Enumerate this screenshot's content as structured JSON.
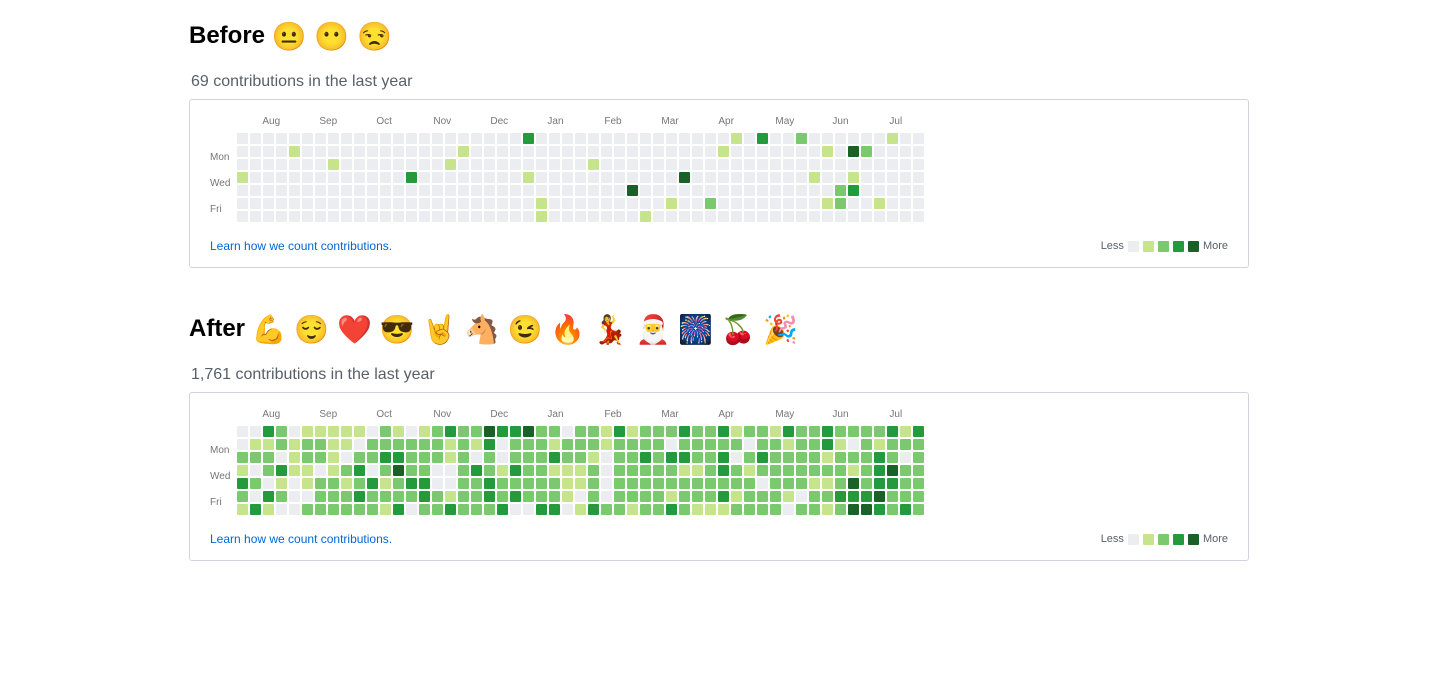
{
  "chart_data": [
    {
      "type": "heatmap",
      "name": "before",
      "title": "Before",
      "subtitle": "69 contributions in the last year",
      "months": [
        "Aug",
        "Sep",
        "Oct",
        "Nov",
        "Dec",
        "Jan",
        "Feb",
        "Mar",
        "Apr",
        "May",
        "Jun",
        "Jul"
      ],
      "day_labels": [
        "Mon",
        "Wed",
        "Fri"
      ],
      "legend": {
        "less": "Less",
        "more": "More",
        "levels": 5
      }
    },
    {
      "type": "heatmap",
      "name": "after",
      "title": "After",
      "subtitle": "1,761 contributions in the last year",
      "months": [
        "Aug",
        "Sep",
        "Oct",
        "Nov",
        "Dec",
        "Jan",
        "Feb",
        "Mar",
        "Apr",
        "May",
        "Jun",
        "Jul"
      ],
      "day_labels": [
        "Mon",
        "Wed",
        "Fri"
      ],
      "legend": {
        "less": "Less",
        "more": "More",
        "levels": 5
      }
    }
  ],
  "before": {
    "title": "Before",
    "emojis": "😐 😶 😒",
    "sub": "69 contributions in the last year",
    "learn": "Learn how we count contributions.",
    "less": "Less",
    "more": "More",
    "months": [
      "Aug",
      "Sep",
      "Oct",
      "Nov",
      "Dec",
      "Jan",
      "Feb",
      "Mar",
      "Apr",
      "May",
      "Jun",
      "Jul"
    ],
    "days": {
      "mon": "Mon",
      "wed": "Wed",
      "fri": "Fri"
    },
    "weeks": [
      [
        0,
        0,
        0,
        1,
        0,
        0,
        0
      ],
      [
        0,
        0,
        0,
        0,
        0,
        0,
        0
      ],
      [
        0,
        0,
        0,
        0,
        0,
        0,
        0
      ],
      [
        0,
        0,
        0,
        0,
        0,
        0,
        0
      ],
      [
        0,
        1,
        0,
        0,
        0,
        0,
        0
      ],
      [
        0,
        0,
        0,
        0,
        0,
        0,
        0
      ],
      [
        0,
        0,
        0,
        0,
        0,
        0,
        0
      ],
      [
        0,
        0,
        1,
        0,
        0,
        0,
        0
      ],
      [
        0,
        0,
        0,
        0,
        0,
        0,
        0
      ],
      [
        0,
        0,
        0,
        0,
        0,
        0,
        0
      ],
      [
        0,
        0,
        0,
        0,
        0,
        0,
        0
      ],
      [
        0,
        0,
        0,
        0,
        0,
        0,
        0
      ],
      [
        0,
        0,
        0,
        0,
        0,
        0,
        0
      ],
      [
        0,
        0,
        0,
        3,
        0,
        0,
        0
      ],
      [
        0,
        0,
        0,
        0,
        0,
        0,
        0
      ],
      [
        0,
        0,
        0,
        0,
        0,
        0,
        0
      ],
      [
        0,
        0,
        1,
        0,
        0,
        0,
        0
      ],
      [
        0,
        1,
        0,
        0,
        0,
        0,
        0
      ],
      [
        0,
        0,
        0,
        0,
        0,
        0,
        0
      ],
      [
        0,
        0,
        0,
        0,
        0,
        0,
        0
      ],
      [
        0,
        0,
        0,
        0,
        0,
        0,
        0
      ],
      [
        0,
        0,
        0,
        0,
        0,
        0,
        0
      ],
      [
        3,
        0,
        0,
        1,
        0,
        0,
        0
      ],
      [
        0,
        0,
        0,
        0,
        0,
        1,
        1
      ],
      [
        0,
        0,
        0,
        0,
        0,
        0,
        0
      ],
      [
        0,
        0,
        0,
        0,
        0,
        0,
        0
      ],
      [
        0,
        0,
        0,
        0,
        0,
        0,
        0
      ],
      [
        0,
        0,
        1,
        0,
        0,
        0,
        0
      ],
      [
        0,
        0,
        0,
        0,
        0,
        0,
        0
      ],
      [
        0,
        0,
        0,
        0,
        0,
        0,
        0
      ],
      [
        0,
        0,
        0,
        0,
        4,
        0,
        0
      ],
      [
        0,
        0,
        0,
        0,
        0,
        0,
        1
      ],
      [
        0,
        0,
        0,
        0,
        0,
        0,
        0
      ],
      [
        0,
        0,
        0,
        0,
        0,
        1,
        0
      ],
      [
        0,
        0,
        0,
        4,
        0,
        0,
        0
      ],
      [
        0,
        0,
        0,
        0,
        0,
        0,
        0
      ],
      [
        0,
        0,
        0,
        0,
        0,
        2,
        0
      ],
      [
        0,
        1,
        0,
        0,
        0,
        0,
        0
      ],
      [
        1,
        0,
        0,
        0,
        0,
        0,
        0
      ],
      [
        0,
        0,
        0,
        0,
        0,
        0,
        0
      ],
      [
        3,
        0,
        0,
        0,
        0,
        0,
        0
      ],
      [
        0,
        0,
        0,
        0,
        0,
        0,
        0
      ],
      [
        0,
        0,
        0,
        0,
        0,
        0,
        0
      ],
      [
        2,
        0,
        0,
        0,
        0,
        0,
        0
      ],
      [
        0,
        0,
        0,
        1,
        0,
        0,
        0
      ],
      [
        0,
        1,
        0,
        0,
        0,
        1,
        0
      ],
      [
        0,
        0,
        0,
        0,
        2,
        2,
        0
      ],
      [
        0,
        4,
        0,
        1,
        3,
        0,
        0
      ],
      [
        0,
        2,
        0,
        0,
        0,
        0,
        0
      ],
      [
        0,
        0,
        0,
        0,
        0,
        1,
        0
      ],
      [
        1,
        0,
        0,
        0,
        0,
        0,
        0
      ],
      [
        0,
        0,
        0,
        0,
        0,
        0,
        0
      ],
      [
        0,
        0,
        0,
        0,
        0,
        0,
        0
      ]
    ]
  },
  "after": {
    "title": "After",
    "emojis": "💪 😌 ❤️ 😎 🤘 🐴 😉 🔥 💃 🎅 🎆 🍒 🎉",
    "sub": "1,761 contributions in the last year",
    "learn": "Learn how we count contributions.",
    "less": "Less",
    "more": "More",
    "months": [
      "Aug",
      "Sep",
      "Oct",
      "Nov",
      "Dec",
      "Jan",
      "Feb",
      "Mar",
      "Apr",
      "May",
      "Jun",
      "Jul"
    ],
    "days": {
      "mon": "Mon",
      "wed": "Wed",
      "fri": "Fri"
    },
    "weeks": [
      [
        0,
        0,
        2,
        1,
        3,
        2,
        1
      ],
      [
        0,
        1,
        2,
        0,
        2,
        0,
        3
      ],
      [
        3,
        1,
        2,
        2,
        0,
        3,
        1
      ],
      [
        2,
        2,
        0,
        3,
        1,
        2,
        0
      ],
      [
        0,
        1,
        1,
        1,
        0,
        0,
        0
      ],
      [
        1,
        2,
        2,
        1,
        1,
        0,
        2
      ],
      [
        1,
        2,
        2,
        0,
        2,
        2,
        2
      ],
      [
        1,
        1,
        1,
        1,
        2,
        2,
        2
      ],
      [
        1,
        1,
        0,
        2,
        1,
        2,
        2
      ],
      [
        1,
        0,
        2,
        3,
        2,
        3,
        2
      ],
      [
        0,
        2,
        2,
        0,
        3,
        2,
        2
      ],
      [
        2,
        2,
        3,
        2,
        1,
        2,
        1
      ],
      [
        1,
        2,
        3,
        4,
        2,
        2,
        3
      ],
      [
        0,
        2,
        2,
        2,
        3,
        2,
        0
      ],
      [
        1,
        2,
        2,
        2,
        3,
        3,
        2
      ],
      [
        2,
        2,
        2,
        0,
        0,
        2,
        2
      ],
      [
        3,
        1,
        1,
        0,
        0,
        1,
        3
      ],
      [
        2,
        2,
        2,
        2,
        2,
        2,
        2
      ],
      [
        2,
        1,
        0,
        3,
        2,
        2,
        2
      ],
      [
        4,
        3,
        2,
        2,
        3,
        3,
        2
      ],
      [
        3,
        0,
        0,
        1,
        2,
        2,
        3
      ],
      [
        3,
        2,
        2,
        3,
        2,
        3,
        0
      ],
      [
        4,
        2,
        2,
        2,
        2,
        2,
        0
      ],
      [
        2,
        2,
        2,
        2,
        2,
        2,
        3
      ],
      [
        2,
        1,
        3,
        1,
        2,
        2,
        3
      ],
      [
        0,
        2,
        2,
        1,
        1,
        1,
        0
      ],
      [
        2,
        2,
        2,
        1,
        1,
        0,
        1
      ],
      [
        2,
        2,
        1,
        2,
        2,
        2,
        3
      ],
      [
        1,
        1,
        0,
        0,
        0,
        0,
        2
      ],
      [
        3,
        2,
        2,
        2,
        2,
        2,
        2
      ],
      [
        1,
        2,
        2,
        2,
        2,
        2,
        1
      ],
      [
        2,
        2,
        3,
        2,
        2,
        2,
        2
      ],
      [
        2,
        2,
        2,
        2,
        2,
        2,
        2
      ],
      [
        2,
        0,
        3,
        2,
        2,
        1,
        3
      ],
      [
        3,
        2,
        3,
        1,
        2,
        2,
        2
      ],
      [
        2,
        2,
        2,
        1,
        2,
        2,
        1
      ],
      [
        2,
        2,
        2,
        2,
        2,
        2,
        1
      ],
      [
        3,
        2,
        3,
        3,
        2,
        3,
        1
      ],
      [
        1,
        2,
        0,
        2,
        2,
        1,
        2
      ],
      [
        2,
        0,
        2,
        1,
        2,
        2,
        2
      ],
      [
        2,
        2,
        3,
        2,
        0,
        2,
        2
      ],
      [
        1,
        2,
        2,
        2,
        2,
        2,
        2
      ],
      [
        3,
        1,
        2,
        2,
        2,
        1,
        0
      ],
      [
        2,
        2,
        2,
        2,
        2,
        0,
        2
      ],
      [
        2,
        2,
        2,
        2,
        1,
        2,
        2
      ],
      [
        3,
        3,
        1,
        2,
        1,
        2,
        1
      ],
      [
        2,
        1,
        2,
        2,
        2,
        3,
        2
      ],
      [
        2,
        0,
        2,
        1,
        4,
        3,
        4
      ],
      [
        2,
        2,
        2,
        2,
        2,
        3,
        4
      ],
      [
        2,
        1,
        3,
        3,
        3,
        4,
        3
      ],
      [
        3,
        2,
        2,
        4,
        3,
        2,
        2
      ],
      [
        1,
        2,
        0,
        2,
        2,
        2,
        3
      ],
      [
        3,
        2,
        2,
        2,
        2,
        2,
        2
      ]
    ]
  }
}
